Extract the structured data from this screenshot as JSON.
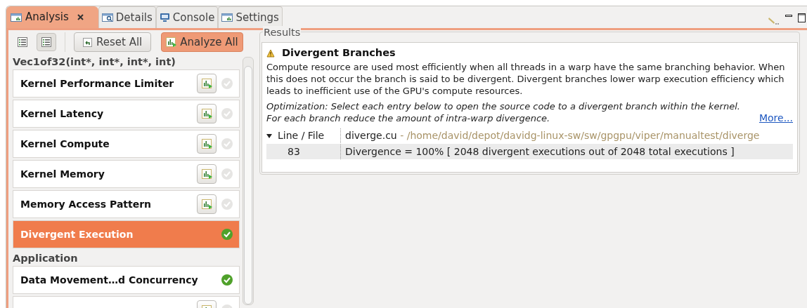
{
  "tabs": [
    {
      "label": "Analysis",
      "kind": "chart",
      "selected": true,
      "closable": true
    },
    {
      "label": "Details",
      "kind": "magnifier",
      "selected": false,
      "closable": false
    },
    {
      "label": "Console",
      "kind": "monitor",
      "selected": false,
      "closable": false
    },
    {
      "label": "Settings",
      "kind": "chart",
      "selected": false,
      "closable": false
    }
  ],
  "toolbar": {
    "view_toggles": [
      {
        "selected": false
      },
      {
        "selected": true
      }
    ],
    "buttons": [
      {
        "label": "Reset All",
        "kind": "reset"
      },
      {
        "label": "Analyze All",
        "kind": "analyze"
      }
    ]
  },
  "sections": [
    {
      "title": "Vec1of32(int*, int*, int*, int)",
      "items": [
        {
          "label": "Kernel Performance Limiter",
          "analyze_button": true,
          "done": false,
          "selected": false
        },
        {
          "label": "Kernel Latency",
          "analyze_button": true,
          "done": false,
          "selected": false
        },
        {
          "label": "Kernel Compute",
          "analyze_button": true,
          "done": false,
          "selected": false
        },
        {
          "label": "Kernel Memory",
          "analyze_button": true,
          "done": false,
          "selected": false
        },
        {
          "label": "Memory Access Pattern",
          "analyze_button": true,
          "done": false,
          "selected": false
        },
        {
          "label": "Divergent Execution",
          "analyze_button": false,
          "done": true,
          "selected": true
        }
      ]
    },
    {
      "title": "Application",
      "items": [
        {
          "label": "Data Movement…d Concurrency",
          "analyze_button": false,
          "done": true,
          "selected": false
        },
        {
          "analyze_button": true,
          "done": false,
          "selected": false
        }
      ]
    }
  ],
  "results": {
    "group_title": "Results",
    "heading": "Divergent Branches",
    "description": "Compute resource are used most efficiently when all threads in a warp have the same branching behavior. When this does not occur the branch is said to be divergent. Divergent branches lower warp execution efficiency which leads to inefficient use of the GPU's compute resources.",
    "optimization": "Optimization: Select each entry below to open the source code to a divergent branch within the kernel. For each branch reduce the amount of intra-warp divergence.",
    "more_link": "More...",
    "table": {
      "header": "Line / File",
      "expanded": true,
      "file": "diverge.cu",
      "path": " - /home/david/depot/davidg-linux-sw/sw/gpgpu/viper/manualtest/diverge",
      "rows": [
        {
          "line": "83",
          "text": "Divergence = 100% [ 2048 divergent executions out of 2048 total executions ]"
        }
      ]
    }
  }
}
